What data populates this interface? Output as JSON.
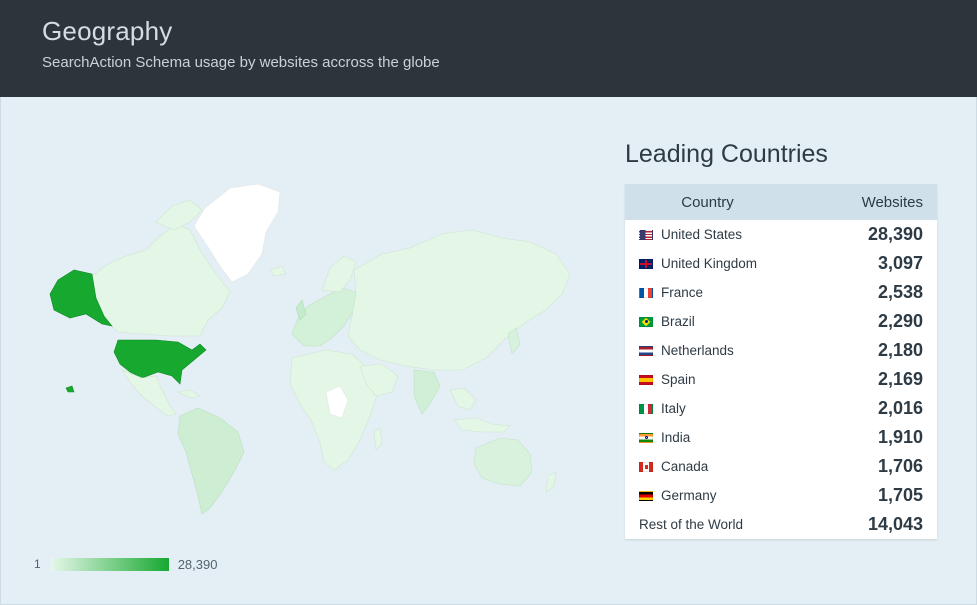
{
  "header": {
    "title": "Geography",
    "subtitle": "SearchAction Schema usage by websites accross the globe"
  },
  "legend": {
    "min": "1",
    "max": "28,390"
  },
  "leading": {
    "title": "Leading Countries",
    "col_country": "Country",
    "col_websites": "Websites",
    "rows": [
      {
        "country": "United States",
        "websites": "28,390",
        "flag": "us"
      },
      {
        "country": "United Kingdom",
        "websites": "3,097",
        "flag": "gb"
      },
      {
        "country": "France",
        "websites": "2,538",
        "flag": "fr"
      },
      {
        "country": "Brazil",
        "websites": "2,290",
        "flag": "br"
      },
      {
        "country": "Netherlands",
        "websites": "2,180",
        "flag": "nl"
      },
      {
        "country": "Spain",
        "websites": "2,169",
        "flag": "es"
      },
      {
        "country": "Italy",
        "websites": "2,016",
        "flag": "it"
      },
      {
        "country": "India",
        "websites": "1,910",
        "flag": "in"
      },
      {
        "country": "Canada",
        "websites": "1,706",
        "flag": "ca"
      },
      {
        "country": "Germany",
        "websites": "1,705",
        "flag": "de"
      },
      {
        "country": "Rest of the World",
        "websites": "14,043",
        "flag": ""
      }
    ]
  },
  "colors": {
    "header_bg": "#2c353c",
    "content_bg": "#e4eff5",
    "map_max": "#17a830",
    "map_light": "#e6f8ea",
    "map_none": "#ffffff",
    "table_header_bg": "#cfe0ea"
  }
}
